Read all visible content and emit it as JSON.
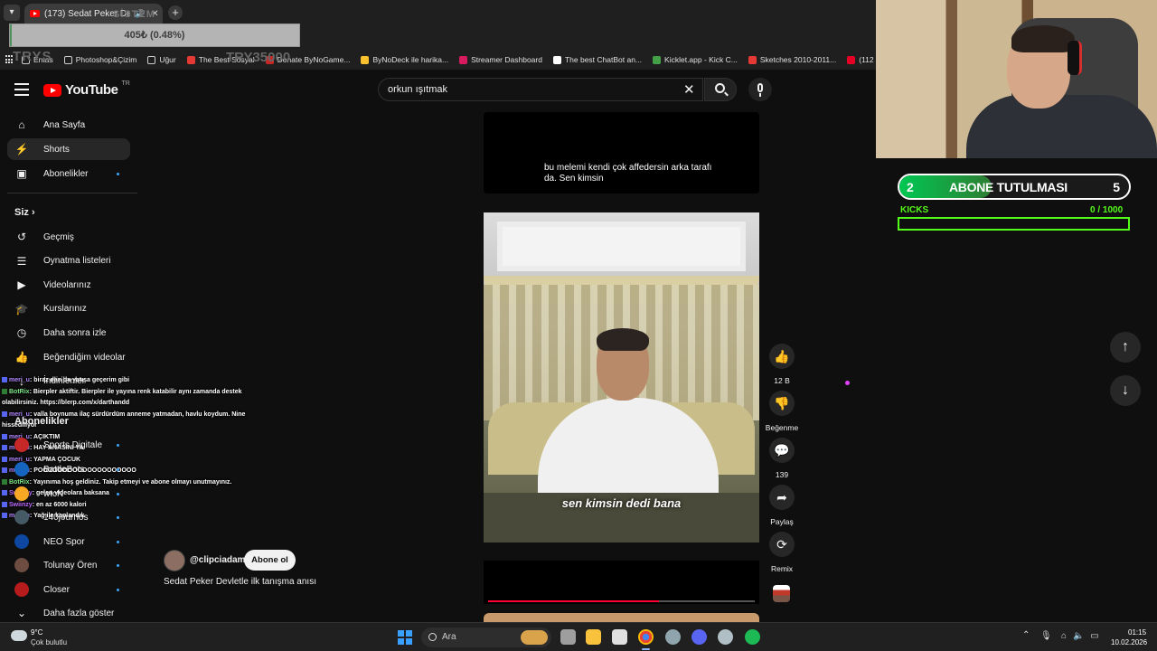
{
  "browser": {
    "tab_title": "(173) Sedat Peker Devlet'e",
    "ghost_title": "SİSTEM",
    "bookmarks": [
      {
        "label": "Entas",
        "icon": "folder-icon"
      },
      {
        "label": "Photoshop&Çizim",
        "icon": "folder-icon"
      },
      {
        "label": "Uğur",
        "icon": "folder-icon"
      },
      {
        "label": "The Best Sosyal",
        "icon": "site-icon"
      },
      {
        "label": "Donate ByNoGame...",
        "icon": "site-icon"
      },
      {
        "label": "ByNoDeck ile harika...",
        "icon": "site-icon"
      },
      {
        "label": "Streamer Dashboard",
        "icon": "site-icon"
      },
      {
        "label": "The best ChatBot an...",
        "icon": "site-icon"
      },
      {
        "label": "Kicklet.app - Kick C...",
        "icon": "site-icon"
      },
      {
        "label": "Sketches 2010-2011...",
        "icon": "site-icon"
      },
      {
        "label": "(112",
        "icon": "pinterest-icon"
      }
    ]
  },
  "stream_overlay": {
    "donation_text": "405₺ (0.48%)",
    "donation_progress": 0.0048,
    "ghost_left": "TRYS",
    "ghost_right": "TRY35000",
    "sub_goal": {
      "current": "2",
      "title": "ABONE TUTULMASI",
      "target": "5",
      "progress": 0.4
    },
    "kicks": {
      "label": "KICKS",
      "count": "0 / 1000",
      "progress": 0
    }
  },
  "youtube": {
    "logo_text": "YouTube",
    "logo_country": "TR",
    "search_value": "orkun ışıtmak",
    "sidebar": {
      "main": [
        {
          "label": "Ana Sayfa",
          "icon": "⌂",
          "icon_name": "home-icon"
        },
        {
          "label": "Shorts",
          "icon": "⚡",
          "icon_name": "shorts-icon"
        },
        {
          "label": "Abonelikler",
          "icon": "▣",
          "icon_name": "subscriptions-icon"
        }
      ],
      "siz_title": "Siz",
      "you": [
        {
          "label": "Geçmiş",
          "icon": "↺",
          "icon_name": "history-icon"
        },
        {
          "label": "Oynatma listeleri",
          "icon": "☰",
          "icon_name": "playlists-icon"
        },
        {
          "label": "Videolarınız",
          "icon": "▶",
          "icon_name": "your-videos-icon"
        },
        {
          "label": "Kurslarınız",
          "icon": "🎓",
          "icon_name": "courses-icon"
        },
        {
          "label": "Daha sonra izle",
          "icon": "◷",
          "icon_name": "watch-later-icon"
        },
        {
          "label": "Beğendiğim videolar",
          "icon": "👍",
          "icon_name": "liked-icon"
        },
        {
          "label": "İndirilenler",
          "icon": "↓",
          "icon_name": "downloads-icon"
        }
      ],
      "subs_title": "Abonelikler",
      "subs": [
        {
          "label": "Sports Digitale",
          "color": "#c62828"
        },
        {
          "label": "BattleBots",
          "color": "#1565c0"
        },
        {
          "label": "wtcN",
          "color": "#f9a825"
        },
        {
          "label": "140journos",
          "color": "#455a64"
        },
        {
          "label": "NEO Spor",
          "color": "#0d47a1"
        },
        {
          "label": "Tolunay Ören",
          "color": "#6d4c41"
        },
        {
          "label": "Closer",
          "color": "#b71c1c"
        }
      ],
      "show_more": "Daha fazla göster"
    },
    "short": {
      "top_caption": "bu melemi kendi çok affedersin arka tarafı da. Sen kimsin",
      "video_caption": "sen kimsin dedi bana",
      "channel": "@clipciadam",
      "subscribe_label": "Abone ol",
      "title": "Sedat Peker  Devletle ilk tanışma anısı",
      "progress": 0.64,
      "actions": [
        {
          "label": "12 B",
          "icon": "👍",
          "name": "like-button"
        },
        {
          "label": "Beğenme",
          "icon": "👎",
          "name": "dislike-button"
        },
        {
          "label": "139",
          "icon": "💬",
          "name": "comments-button"
        },
        {
          "label": "Paylaş",
          "icon": "➦",
          "name": "share-button"
        },
        {
          "label": "Remix",
          "icon": "⟳",
          "name": "remix-button"
        }
      ]
    }
  },
  "chat": [
    {
      "user": "meri_u",
      "text": ": biraz dan da yatışa geçerim gibi",
      "type": "meri"
    },
    {
      "user": "BotRix",
      "text": ": Bierpler aktiftir. Bierpler ile yayına renk katabilir aynı zamanda destek olabilirsiniz. https://blerp.com/x/darthandd",
      "type": "bot"
    },
    {
      "user": "meri_u",
      "text": ": valla boynuma ilaç sürdürdüm anneme yatmadan, havlu koydum. Nine hissediliyor",
      "type": "meri"
    },
    {
      "user": "meri_u",
      "text": ": AÇIKTIM",
      "type": "meri"
    },
    {
      "user": "meri_u",
      "text": ": HAY ANASINI YA",
      "type": "meri"
    },
    {
      "user": "meri_u",
      "text": ": YAPMA ÇOCUK",
      "type": "meri"
    },
    {
      "user": "meri_u",
      "text": ": POOOOOOOOOOOOOOOOOOOO",
      "type": "meri"
    },
    {
      "user": "BotRix",
      "text": ": Yayınıma hoş geldiniz. Takip etmeyi ve abone olmayı unutmayınız.",
      "type": "bot"
    },
    {
      "user": "Swiinzy",
      "text": ": gelen videolara baksana",
      "type": "sw"
    },
    {
      "user": "Swiinzy",
      "text": ": en az 6000 kalori",
      "type": "sw"
    },
    {
      "user": "meri_u",
      "text": ": Yağ ile kaplandık",
      "type": "meri"
    }
  ],
  "taskbar": {
    "weather_temp": "9°C",
    "weather_desc": "Çok bulutlu",
    "search_placeholder": "Ara",
    "time": "01:15",
    "date": "10.02.2026"
  }
}
